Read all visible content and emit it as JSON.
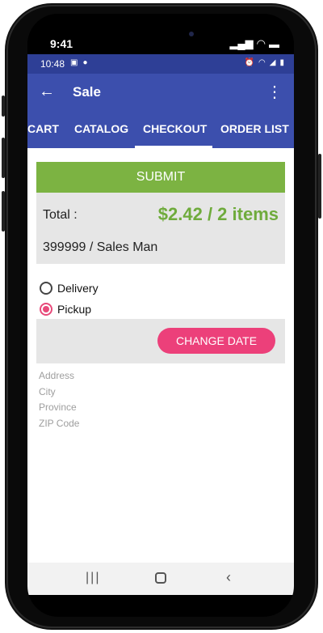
{
  "ios_status": {
    "time": "9:41"
  },
  "android_status": {
    "time": "10:48",
    "left_icons": [
      "image-icon",
      "bulb-icon"
    ],
    "right_icons": [
      "alarm-icon",
      "wifi-icon",
      "signal-icon",
      "battery-icon"
    ]
  },
  "appbar": {
    "title": "Sale",
    "back_icon": "arrow-back-icon",
    "more_icon": "more-vert-icon"
  },
  "tabs": [
    {
      "label": "CART",
      "active": false
    },
    {
      "label": "CATALOG",
      "active": false
    },
    {
      "label": "CHECKOUT",
      "active": true
    },
    {
      "label": "ORDER LIST",
      "active": false
    }
  ],
  "checkout": {
    "submit_label": "SUBMIT",
    "total_label": "Total :",
    "total_value": "$2.42 / 2 items",
    "customer": "399999 / Sales Man",
    "delivery_options": [
      {
        "label": "Delivery",
        "selected": false
      },
      {
        "label": "Pickup",
        "selected": true
      }
    ],
    "change_date_label": "CHANGE DATE",
    "address_fields": [
      "Address",
      "City",
      "Province",
      "ZIP Code"
    ]
  },
  "colors": {
    "primary": "#3c4fad",
    "status_bar": "#2e3f96",
    "submit": "#7cb342",
    "total": "#6fab3c",
    "accent": "#ec407a",
    "panel": "#e6e6e6"
  }
}
